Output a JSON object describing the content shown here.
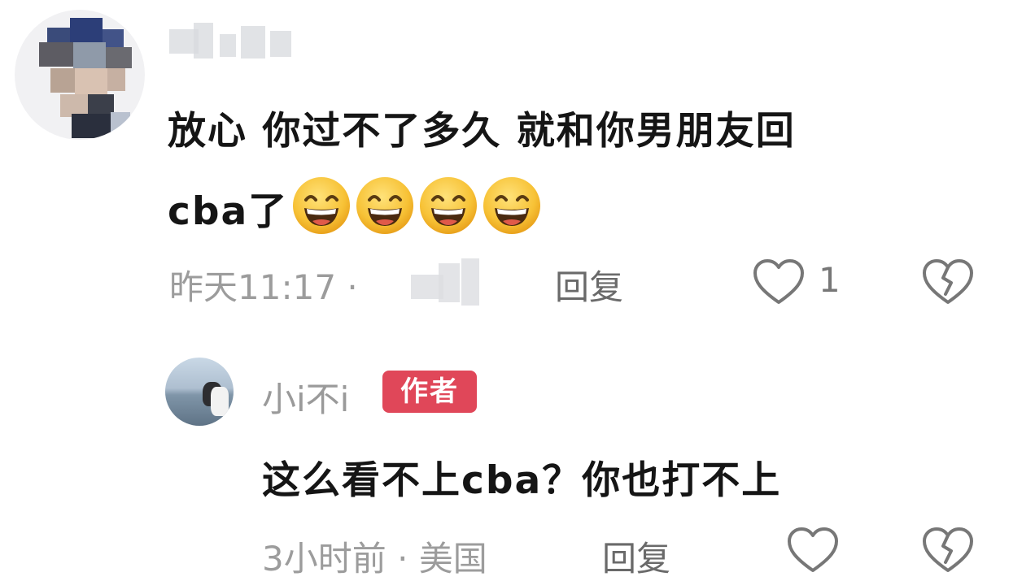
{
  "comment": {
    "line1": "放心 你过不了多久 就和你男朋友回",
    "line2": "cba了",
    "emoji_count": 4,
    "emoji_name": "grinning-face",
    "time": "昨天11:17 ·",
    "reply_label": "回复",
    "like_count": "1"
  },
  "reply": {
    "username": "小i不i",
    "badge": "作者",
    "text": "这么看不上cba？你也打不上",
    "time": "3小时前 · 美国",
    "reply_label": "回复"
  },
  "colors": {
    "badge_bg": "#e04759",
    "meta_text": "#9c9c9c",
    "body_text": "#151515"
  }
}
